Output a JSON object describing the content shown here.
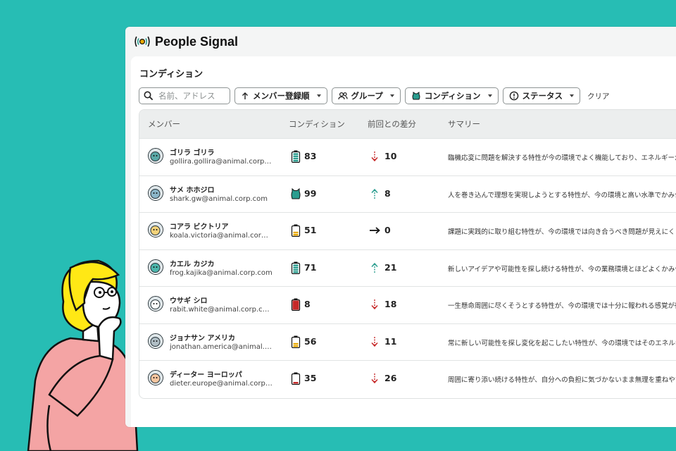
{
  "app": {
    "title": "People Signal"
  },
  "page": {
    "title": "コンディション"
  },
  "filters": {
    "search_placeholder": "名前、アドレス",
    "sort_label": "メンバー登録順",
    "group_label": "グループ",
    "condition_label": "コンディション",
    "status_label": "ステータス",
    "clear_label": "クリア"
  },
  "table": {
    "headers": {
      "member": "メンバー",
      "condition": "コンディション",
      "diff": "前回との差分",
      "summary": "サマリー"
    },
    "rows": [
      {
        "name": "ゴリラ ゴリラ",
        "email": "gollira.gollira@animal.corp.com",
        "condition": "83",
        "diff": "10",
        "trend": "down",
        "battery": "high",
        "summary": "臨機応変に問題を解決する特性が今の環境でよく機能しており、エネルギーが"
      },
      {
        "name": "サメ ホホジロ",
        "email": "shark.gw@animal.corp.com",
        "condition": "99",
        "diff": "8",
        "trend": "up",
        "battery": "max",
        "summary": "人を巻き込んで理想を実現しようとする特性が、今の環境と高い水準でかみ合"
      },
      {
        "name": "コアラ ビクトリア",
        "email": "koala.victoria@animal.corp.c…",
        "condition": "51",
        "diff": "0",
        "trend": "flat",
        "battery": "mid",
        "summary": "課題に実践的に取り組む特性が、今の環境では向き合うべき問題が見えにくく"
      },
      {
        "name": "カエル カジカ",
        "email": "frog.kajika@animal.corp.com",
        "condition": "71",
        "diff": "21",
        "trend": "up",
        "battery": "high",
        "summary": "新しいアイデアや可能性を探し続ける特性が、今の業務環境とほどよくかみ合"
      },
      {
        "name": "ウサギ シロ",
        "email": "rabit.white@animal.corp.com",
        "condition": "8",
        "diff": "18",
        "trend": "down",
        "battery": "low",
        "summary": "一生懸命周囲に尽くそうとする特性が、今の環境では十分に報われる感覚が得"
      },
      {
        "name": "ジョナサン アメリカ",
        "email": "jonathan.america@animal.cor…",
        "condition": "56",
        "diff": "11",
        "trend": "down",
        "battery": "mid",
        "summary": "常に新しい可能性を探し変化を起こしたい特性が、今の環境ではそのエネルギ"
      },
      {
        "name": "ディーター ヨーロッパ",
        "email": "dieter.europe@animal.corp.c…",
        "condition": "35",
        "diff": "26",
        "trend": "down",
        "battery": "lowmid",
        "summary": "周囲に寄り添い続ける特性が、自分への負担に気づかないまま無理を重ねやす"
      }
    ]
  },
  "colors": {
    "background": "#27bdb4",
    "teal": "#2a9d8f",
    "red": "#c62828",
    "amber": "#e9a800"
  }
}
